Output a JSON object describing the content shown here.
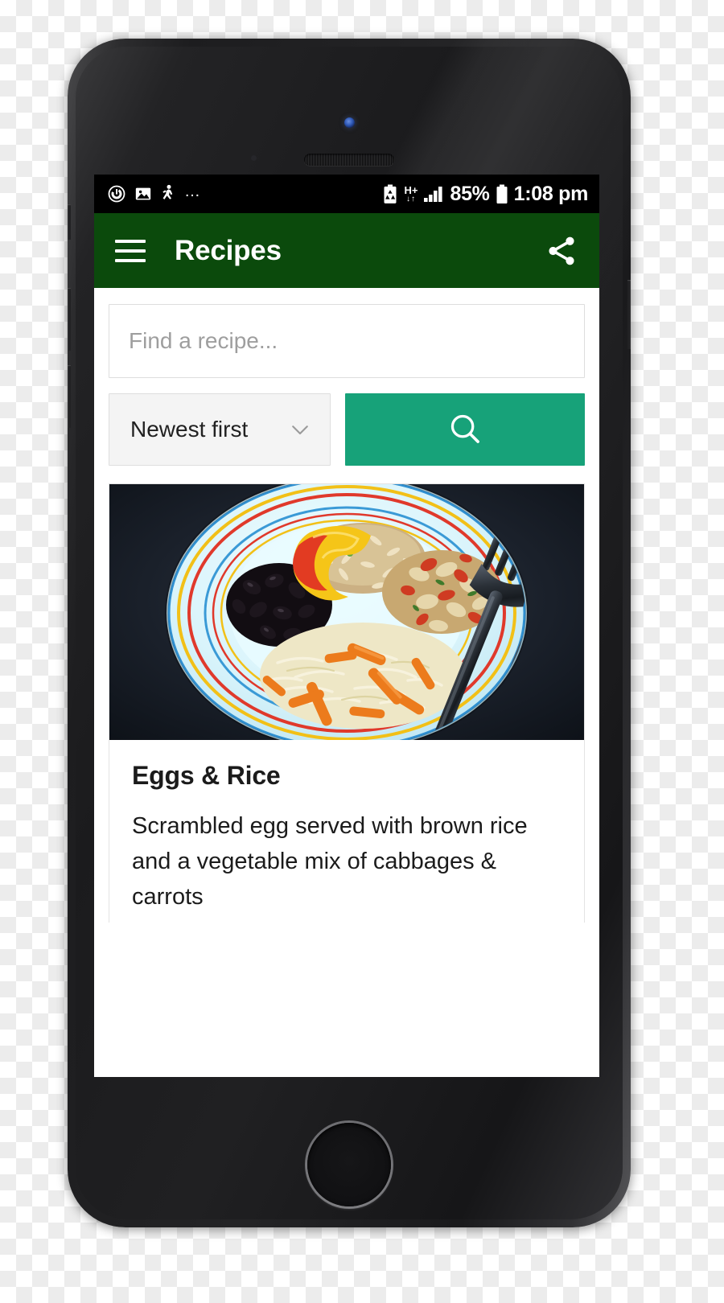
{
  "device": {
    "frame_name": "smartphone-mockup",
    "hardware": {
      "camera": "front-camera",
      "earpiece": "earpiece-speaker",
      "home": "home-button",
      "silent_switch": "silent-switch",
      "volume_up": "volume-up-button",
      "volume_down": "volume-down-button",
      "power": "power-button"
    }
  },
  "status_bar": {
    "left_icons": [
      {
        "name": "alarm-icon",
        "glyph": "alarm"
      },
      {
        "name": "screenshot-image-icon",
        "glyph": "image"
      },
      {
        "name": "activity-walking-icon",
        "glyph": "walking"
      },
      {
        "name": "more-notifications-icon",
        "glyph": "..."
      }
    ],
    "battery_saver_icon": "battery-saver-icon",
    "network_type": "H+",
    "signal_icon": "signal-bars-icon",
    "battery_percent": "85%",
    "battery_icon": "battery-icon",
    "time": "1:08 pm"
  },
  "app_bar": {
    "menu_icon": "hamburger-menu-icon",
    "title": "Recipes",
    "share_icon": "share-icon",
    "background_color": "#0b4a0c"
  },
  "search": {
    "placeholder": "Find a recipe...",
    "value": "",
    "sort_selected": "Newest first",
    "sort_options": [
      "Newest first"
    ],
    "chevron_icon": "chevron-down-icon",
    "button_icon": "search-icon",
    "button_color": "#17a279"
  },
  "recipes": [
    {
      "title": "Eggs & Rice",
      "description": "Scrambled egg served with brown rice and a vegetable mix of cabbages & carrots",
      "photo_alt": "plate-of-eggs-and-rice"
    }
  ],
  "colors": {
    "brand_green": "#0b4a0c",
    "accent_teal": "#17a279",
    "text_primary": "#1b1b1b",
    "placeholder": "#9e9e9e",
    "field_border": "#dddddd",
    "sort_bg": "#f4f4f4"
  }
}
